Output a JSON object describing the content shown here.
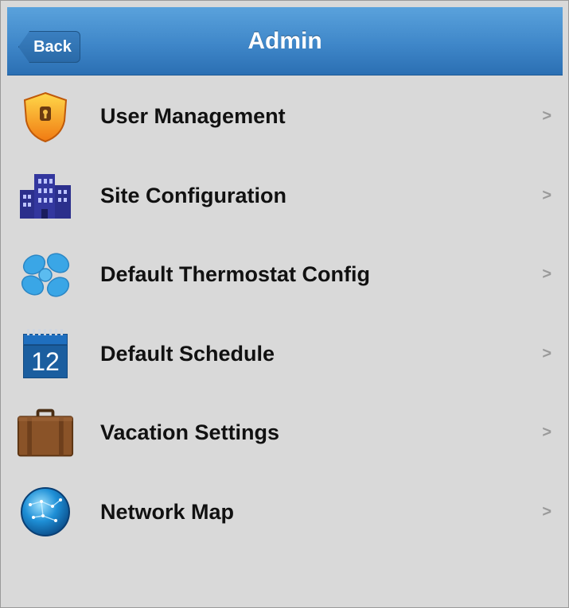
{
  "header": {
    "back_label": "Back",
    "title": "Admin"
  },
  "menu": {
    "items": [
      {
        "label": "User Management",
        "icon": "shield-lock-icon"
      },
      {
        "label": "Site Configuration",
        "icon": "buildings-icon"
      },
      {
        "label": "Default Thermostat Config",
        "icon": "fan-icon"
      },
      {
        "label": "Default Schedule",
        "icon": "calendar-icon"
      },
      {
        "label": "Vacation Settings",
        "icon": "suitcase-icon"
      },
      {
        "label": "Network Map",
        "icon": "globe-icon"
      }
    ],
    "calendar_day": "12",
    "chevron": ">"
  },
  "colors": {
    "header": "#3f87c9",
    "background": "#d9d9d9"
  }
}
